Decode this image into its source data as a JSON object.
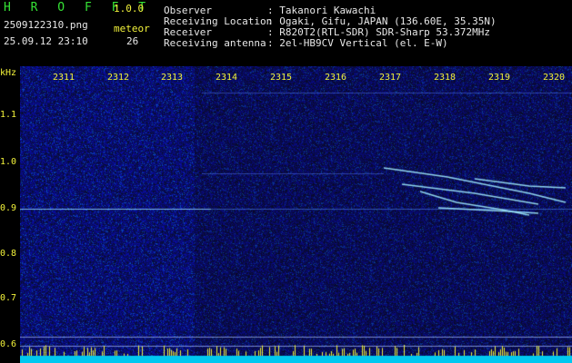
{
  "app": {
    "name": "H R O F F T",
    "version": "1.0.0",
    "filename": "2509122310.png",
    "datetime": "25.09.12 23:10",
    "meteor_label": "meteor",
    "meteor_count": "26"
  },
  "info": {
    "rows": [
      {
        "label": "Observer",
        "value": ": Takanori Kawachi"
      },
      {
        "label": "Receiving Location",
        "value": ": Ogaki, Gifu, JAPAN (136.60E, 35.35N)"
      },
      {
        "label": "Receiver",
        "value": ": R820T2(RTL-SDR) SDR-Sharp 53.372MHz"
      },
      {
        "label": "Receiving antenna",
        "value": ": 2el-HB9CV Vertical (el. E-W)"
      }
    ]
  },
  "axes": {
    "y_unit": "kHz",
    "y_ticks": [
      "1.1",
      "1.0",
      "0.9",
      "0.8",
      "0.7",
      "0.6"
    ],
    "x_ticks": [
      "2311",
      "2312",
      "2313",
      "2314",
      "2315",
      "2316",
      "2317",
      "2318",
      "2319",
      "2320"
    ]
  },
  "colors": {
    "background": "#000000",
    "noise_dark": "#0a0a3c",
    "noise_light": "#1e28a0",
    "signal": "#9fe8ff",
    "baseline": "#00d2ff",
    "text_green": "#35e235",
    "text_yellow": "#f2f23a"
  }
}
